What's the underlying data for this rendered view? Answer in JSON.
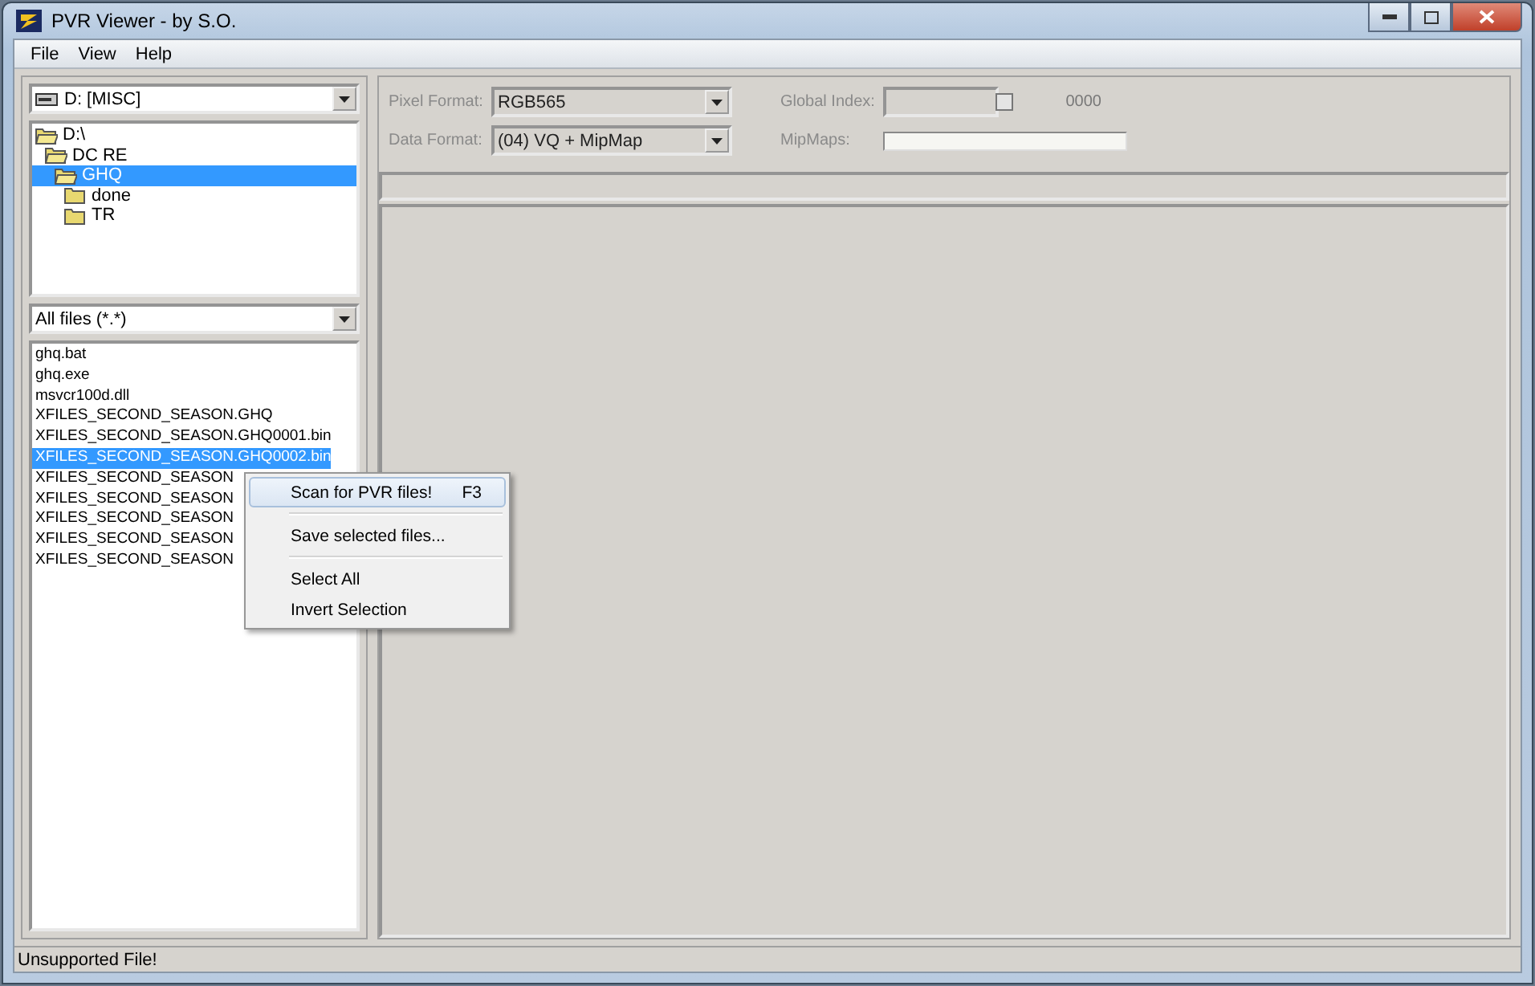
{
  "window": {
    "title": "PVR Viewer - by S.O."
  },
  "menu_bar": [
    "File",
    "View",
    "Help"
  ],
  "drive_select": {
    "value": "D: [MISC]"
  },
  "folder_tree": [
    {
      "label": "D:\\",
      "selected": false,
      "expanded": true,
      "children": [
        {
          "label": "DC RE",
          "selected": false,
          "expanded": true,
          "children": [
            {
              "label": "GHQ",
              "selected": true,
              "expanded": true,
              "children": [
                {
                  "label": "done",
                  "selected": false,
                  "expanded": false
                },
                {
                  "label": "TR",
                  "selected": false,
                  "expanded": false
                }
              ]
            }
          ]
        }
      ]
    }
  ],
  "filter_select": {
    "value": "All files (*.*)"
  },
  "files": [
    {
      "name": "ghq.bat",
      "selected": false
    },
    {
      "name": "ghq.exe",
      "selected": false
    },
    {
      "name": "msvcr100d.dll",
      "selected": false
    },
    {
      "name": "XFILES_SECOND_SEASON.GHQ",
      "selected": false
    },
    {
      "name": "XFILES_SECOND_SEASON.GHQ0001.bin",
      "selected": false
    },
    {
      "name": "XFILES_SECOND_SEASON.GHQ0002.bin",
      "selected": true
    },
    {
      "name": "XFILES_SECOND_SEASON",
      "selected": false
    },
    {
      "name": "XFILES_SECOND_SEASON",
      "selected": false
    },
    {
      "name": "XFILES_SECOND_SEASON",
      "selected": false
    },
    {
      "name": "XFILES_SECOND_SEASON",
      "selected": false
    },
    {
      "name": "XFILES_SECOND_SEASON",
      "selected": false
    }
  ],
  "properties": {
    "pixel_format": {
      "label": "Pixel Format:",
      "value": "RGB565",
      "disabled": true
    },
    "data_format": {
      "label": "Data Format:",
      "value": "(04) VQ + MipMap",
      "disabled": true
    },
    "global_index": {
      "label": "Global Index:",
      "checked": false,
      "reading": "0000"
    },
    "mipmaps": {
      "label": "MipMaps:"
    }
  },
  "context_menu": [
    [
      {
        "label": "Scan for PVR files!",
        "shortcut": "F3",
        "selected": true
      }
    ],
    [
      {
        "label": "Save selected files...",
        "selected": false
      }
    ],
    [
      {
        "label": "Select All",
        "selected": false
      },
      {
        "label": "Invert Selection",
        "selected": false
      }
    ]
  ],
  "status_bar": "Unsupported File!"
}
